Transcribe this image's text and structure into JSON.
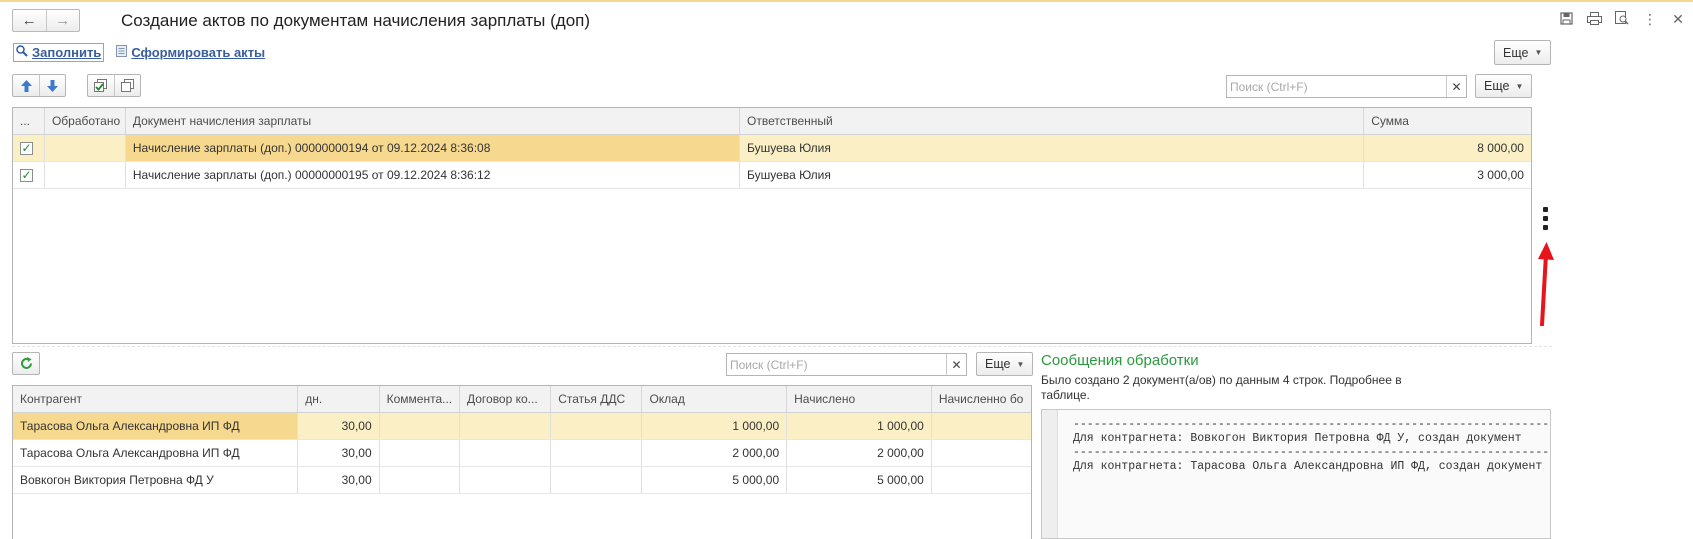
{
  "window": {
    "title": "Создание актов по документам начисления зарплаты (доп)",
    "back_icon": "←",
    "forward_icon": "→",
    "tool_icons": [
      "save-icon",
      "print-icon",
      "preview-icon",
      "more-vert-icon",
      "close-icon"
    ]
  },
  "commands": {
    "fill_label": "Заполнить",
    "create_acts_label": "Сформировать акты",
    "more_label": "Еще"
  },
  "top_table": {
    "search_placeholder": "Поиск (Ctrl+F)",
    "more_label": "Еще",
    "columns": [
      "...",
      "Обработано",
      "Документ начисления зарплаты",
      "Ответственный",
      "Сумма"
    ],
    "rows": [
      {
        "checked": true,
        "processed": "",
        "document": "Начисление зарплаты (доп.) 00000000194 от 09.12.2024 8:36:08",
        "responsible": "Бушуева Юлия",
        "sum": "8 000,00"
      },
      {
        "checked": true,
        "processed": "",
        "document": "Начисление зарплаты (доп.) 00000000195 от 09.12.2024 8:36:12",
        "responsible": "Бушуева Юлия",
        "sum": "3 000,00"
      }
    ]
  },
  "bottom_table": {
    "search_placeholder": "Поиск (Ctrl+F)",
    "more_label": "Еще",
    "columns": [
      "Контрагент",
      "дн.",
      "Коммента...",
      "Договор ко...",
      "Статья ДДС",
      "Оклад",
      "Начислено",
      "Начисленно бо"
    ],
    "rows": [
      {
        "contractor": "Тарасова Ольга Александровна ИП ФД",
        "days": "30,00",
        "comment": "",
        "contract": "",
        "dds": "",
        "salary": "1 000,00",
        "accrued": "1 000,00",
        "accrued_bonus": ""
      },
      {
        "contractor": "Тарасова Ольга Александровна ИП ФД",
        "days": "30,00",
        "comment": "",
        "contract": "",
        "dds": "",
        "salary": "2 000,00",
        "accrued": "2 000,00",
        "accrued_bonus": ""
      },
      {
        "contractor": "Вовкогон Виктория Петровна ФД У",
        "days": "30,00",
        "comment": "",
        "contract": "",
        "dds": "",
        "salary": "5 000,00",
        "accrued": "5 000,00",
        "accrued_bonus": ""
      }
    ]
  },
  "messages": {
    "title": "Сообщения обработки",
    "summary": "Было создано 2 документ(а/ов) по данным 4 строк. Подробнее в таблице.",
    "log_lines": [
      "-------------------------------------------------------------------------",
      "Для контрагнета: Вовкогон Виктория Петровна ФД У, создан документ",
      "-------------------------------------------------------------------------",
      "Для контрагнета: Тарасова Ольга Александровна ИП ФД, создан документ"
    ]
  },
  "colors": {
    "selected_row": "#fbefc6",
    "focused_cell": "#f6d98f",
    "messages_title": "#2a9a3e",
    "link": "#3a5e9c",
    "annotation_arrow": "#e8141c"
  }
}
